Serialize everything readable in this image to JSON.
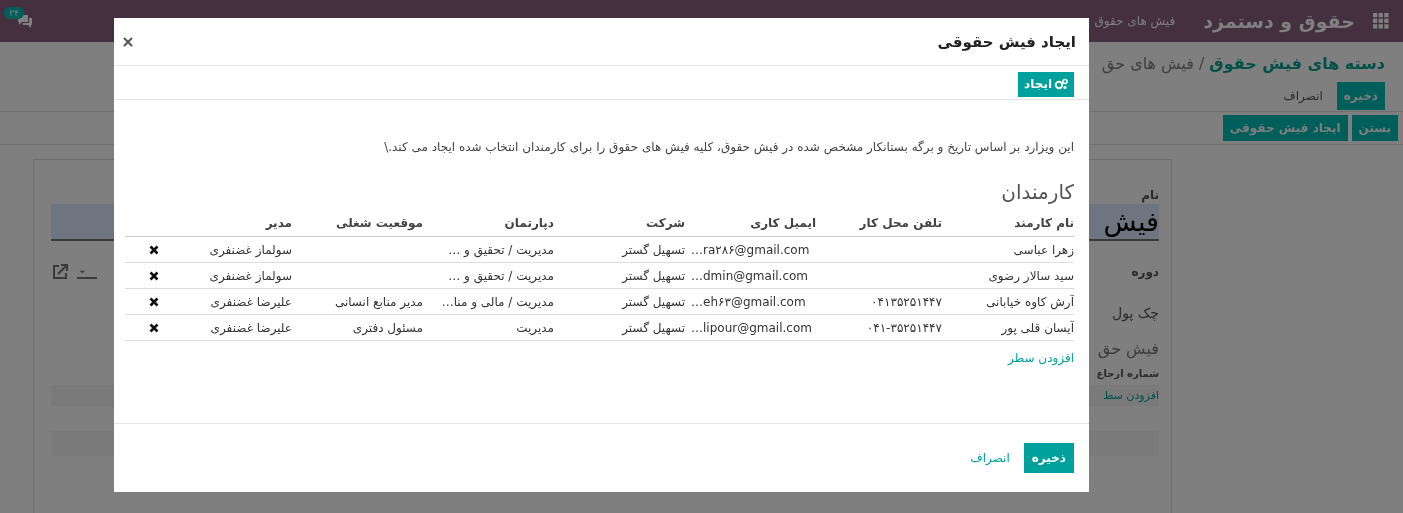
{
  "navbar": {
    "app_title": "حقوق و دستمزد",
    "menu": [
      {
        "label": "فیش های حقوق"
      }
    ],
    "chat_badge": "۳۴"
  },
  "breadcrumb_separator": "/",
  "breadcrumb": [
    {
      "label": "دسته های فیش حقوق",
      "kind": "link"
    },
    {
      "label": "فیش های حق",
      "kind": "current"
    }
  ],
  "form_buttons": [
    {
      "label": "ذخیره",
      "kind": "primary"
    },
    {
      "label": "انصراف",
      "kind": "link"
    }
  ],
  "status_buttons": [
    {
      "label": "بستن"
    },
    {
      "label": "ایجاد فیش حقوقی"
    }
  ],
  "sheet": {
    "name_label": "نام",
    "name_value": "فیش",
    "fields": [
      {
        "label": "دوره"
      },
      {
        "label": "چک پول"
      }
    ],
    "section_title": "فیش حق",
    "ref_label": "شماره ارجاع",
    "add_line": "افزودن سط"
  },
  "dialog": {
    "title": "ایجاد فیش حقوقی",
    "toolbar_button": "ایجاد",
    "description": "این ویزارد بر اساس تاریخ و برگه بستانکار مشخص شده در فیش حقوق، کلیه فیش های حقوق را برای کارمندان انتخاب شده ایجاد می کند.\\",
    "section_title": "کارمندان",
    "table": {
      "columns": [
        "نام کارمند",
        "تلفن محل کار",
        "ایمیل کاری",
        "شرکت",
        "دپارتمان",
        "موقعیت شغلی",
        "مدیر"
      ],
      "rows": [
        {
          "cells": [
            "زهرا عباسی",
            "",
            "…ra۲۸۶@gmail.com",
            "تسهیل گستر",
            "مدیریت / تحقیق و …",
            "",
            "سولماز غضنفری"
          ]
        },
        {
          "cells": [
            "سید سالار رضوی",
            "",
            "…dmin@gmail.com",
            "تسهیل گستر",
            "مدیریت / تحقیق و …",
            "",
            "سولماز غضنفری"
          ]
        },
        {
          "cells": [
            "آرش کاوه خیابانی",
            "۰۴۱۳۵۲۵۱۴۴۷",
            "…eh۶۳@gmail.com",
            "تسهیل گستر",
            "مدیریت / مالی و منا…",
            "مدیر منابع انسانی",
            "علیرضا غضنفری"
          ]
        },
        {
          "cells": [
            "آیسان قلی پور",
            "۰۴۱-۳۵۲۵۱۴۴۷",
            "…lipour@gmail.com",
            "تسهیل گستر",
            "مدیریت",
            "مسئول دفتری",
            "علیرضا غضنفری"
          ]
        }
      ]
    },
    "add_line": "افزودن سطر",
    "footer_buttons": [
      {
        "label": "ذخیره",
        "kind": "primary"
      },
      {
        "label": "انصراف",
        "kind": "link"
      }
    ]
  }
}
